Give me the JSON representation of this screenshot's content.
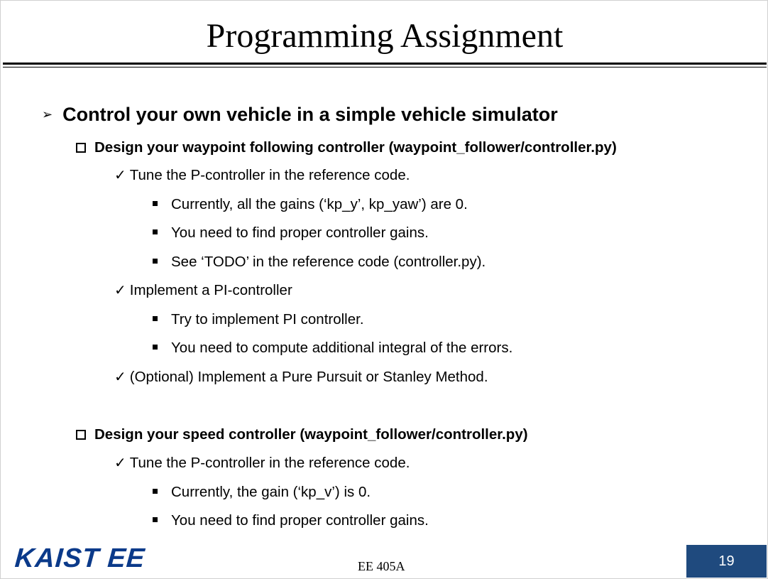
{
  "slide": {
    "title": "Programming Assignment",
    "main_bullet": "Control your own vehicle in a simple vehicle simulator",
    "sections": [
      {
        "heading": "Design your waypoint following controller (waypoint_follower/controller.py)",
        "items": [
          {
            "text": "Tune the P-controller in the reference code.",
            "sub": [
              "Currently, all the gains (‘kp_y’, kp_yaw’) are 0.",
              "You need to find proper controller gains.",
              "See ‘TODO’ in the reference code (controller.py)."
            ]
          },
          {
            "text": "Implement a PI-controller",
            "sub": [
              "Try to implement PI controller.",
              "You need to compute additional integral of the errors."
            ]
          },
          {
            "text": "(Optional) Implement a Pure Pursuit or Stanley Method.",
            "sub": []
          }
        ]
      },
      {
        "heading": "Design your speed controller (waypoint_follower/controller.py)",
        "items": [
          {
            "text": "Tune the P-controller in the reference code.",
            "sub": [
              "Currently, the gain (‘kp_v’) is 0.",
              "You need to find proper controller gains."
            ]
          }
        ]
      }
    ]
  },
  "footer": {
    "logo_text": "KAIST EE",
    "course": "EE 405A",
    "page_number": "19",
    "logo_color": "#0b3a8a",
    "page_box_color": "#1f4a7e"
  },
  "markers": {
    "arrow": "➢",
    "check": "✓"
  }
}
